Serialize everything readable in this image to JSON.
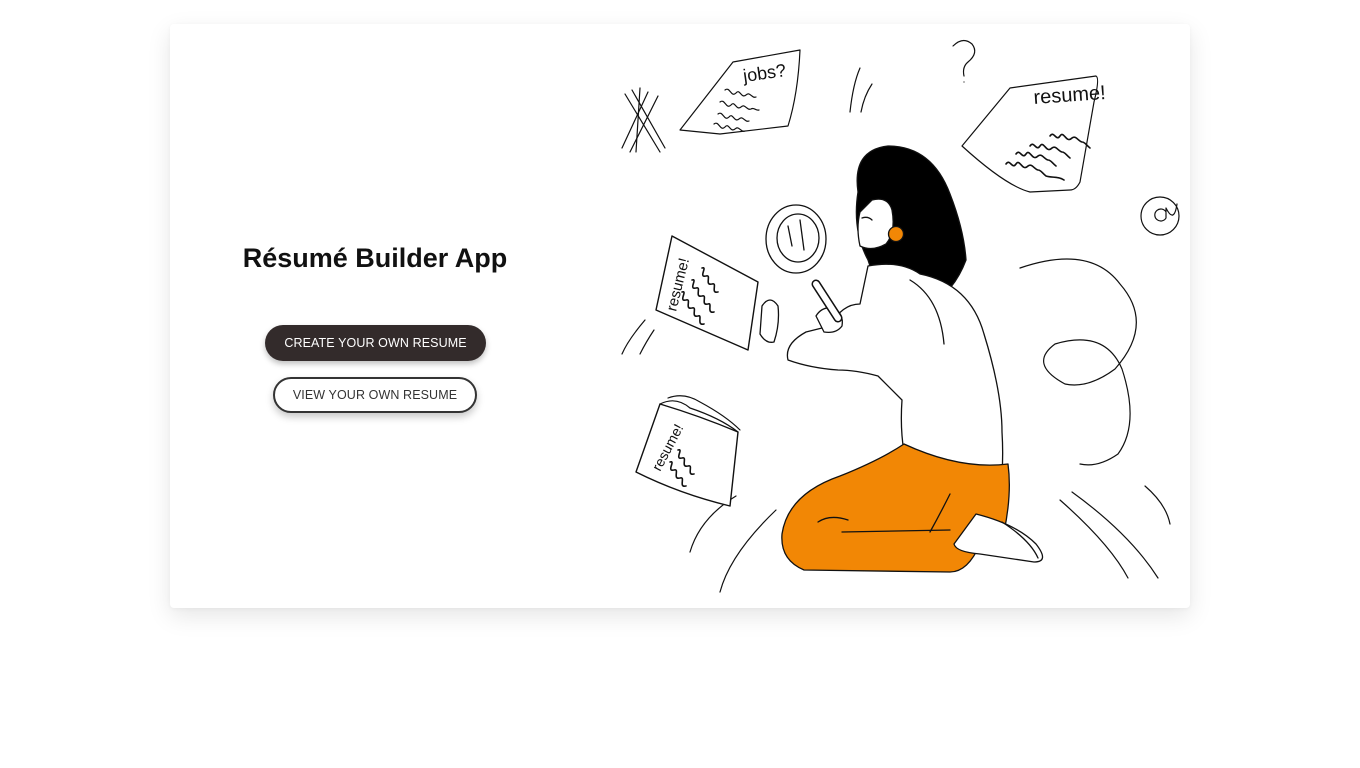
{
  "app": {
    "title": "Résumé Builder App"
  },
  "actions": {
    "create_label": "CREATE YOUR OWN RESUME",
    "view_label": "VIEW YOUR OWN RESUME"
  },
  "illustration": {
    "paper_jobs": "jobs?",
    "paper_resume_top": "resume!",
    "paper_resume_held": "resume!",
    "paper_resume_book": "resume!",
    "accent_color": "#f28705"
  }
}
